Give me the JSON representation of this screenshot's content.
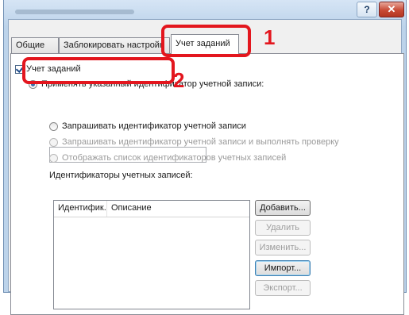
{
  "window": {
    "help_glyph": "?",
    "close_glyph": "✕"
  },
  "tabs": [
    {
      "label": "Общие",
      "active": false
    },
    {
      "label": "Заблокировать настройк",
      "active": false
    },
    {
      "label": "Учет заданий",
      "active": true
    }
  ],
  "job_accounting": {
    "checkbox_label": "Учет заданий",
    "checked": true,
    "apply_option_label": "Применять указанный идентификатор учетной записи:",
    "account_id_input_value": "",
    "prompt_option_label": "Запрашивать идентификатор учетной записи",
    "prompt_validate_option_label": "Запрашивать идентификатор учетной записи и выполнять проверку",
    "display_list_option_label": "Отображать список идентификаторов учетных записей",
    "list_caption": "Идентификаторы учетных записей:",
    "list_columns": [
      "Идентифик...",
      "Описание"
    ],
    "list_rows": []
  },
  "buttons": {
    "add": "Добавить...",
    "delete": "Удалить",
    "edit": "Изменить...",
    "import": "Импорт...",
    "export": "Экспорт..."
  },
  "callouts": {
    "step1": "1",
    "step2": "2"
  },
  "colors": {
    "callout_red": "#e3161e",
    "window_frame": "#bcd3ea",
    "close_button": "#c84a35"
  }
}
